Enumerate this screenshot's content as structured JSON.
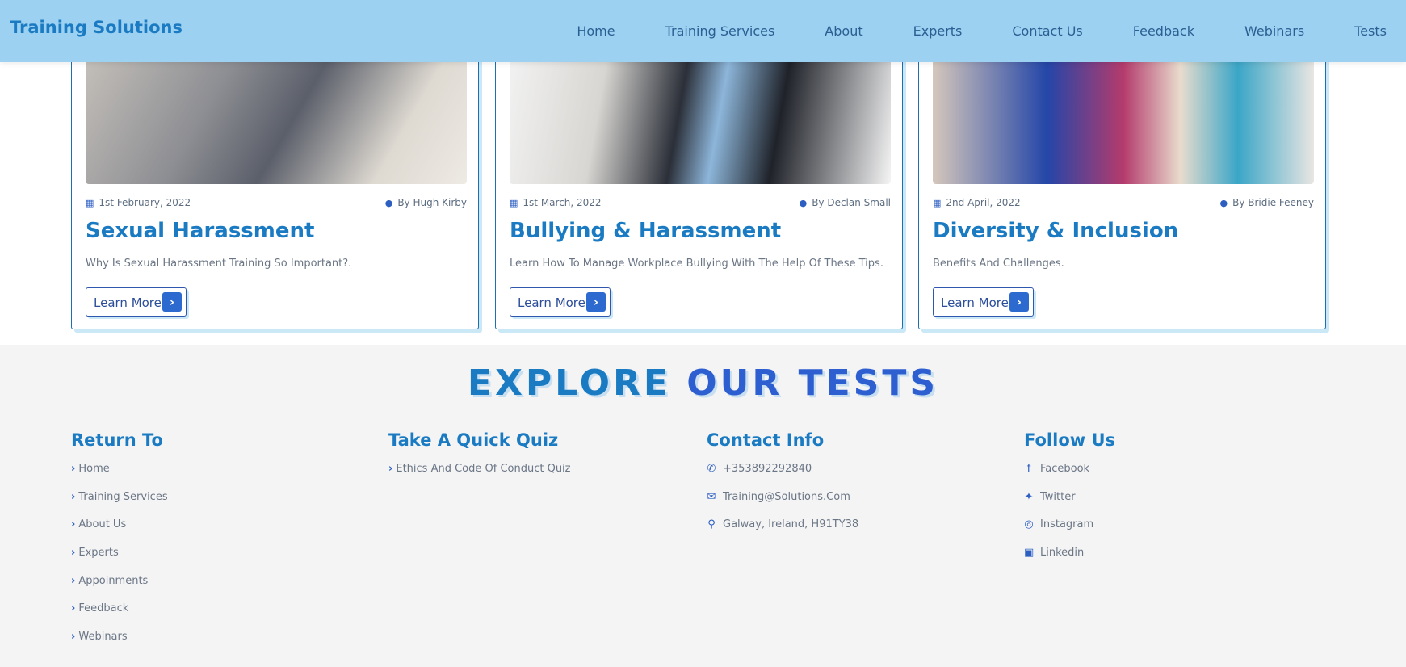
{
  "header": {
    "brand": "Training Solutions",
    "nav": [
      "Home",
      "Training Services",
      "About",
      "Experts",
      "Contact Us",
      "Feedback",
      "Webinars",
      "Tests"
    ]
  },
  "cards": [
    {
      "date": "1st February, 2022",
      "author": "By Hugh Kirby",
      "title": "Sexual Harassment",
      "description": "Why Is Sexual Harassment Training So Important?.",
      "button": "Learn More"
    },
    {
      "date": "1st March, 2022",
      "author": "By Declan Small",
      "title": "Bullying & Harassment",
      "description": "Learn How To Manage Workplace Bullying With The Help Of These Tips.",
      "button": "Learn More"
    },
    {
      "date": "2nd April, 2022",
      "author": "By Bridie Feeney",
      "title": "Diversity & Inclusion",
      "description": "Benefits And Challenges.",
      "button": "Learn More"
    }
  ],
  "footer": {
    "heading_part1": "EXPLORE",
    "heading_part2": "OUR TESTS",
    "return_to": {
      "title": "Return To",
      "links": [
        "Home",
        "Training Services",
        "About Us",
        "Experts",
        "Appoinments",
        "Feedback",
        "Webinars"
      ]
    },
    "quiz": {
      "title": "Take A Quick Quiz",
      "links": [
        "Ethics And Code Of Conduct Quiz"
      ]
    },
    "contact": {
      "title": "Contact Info",
      "phone": "+353892292840",
      "email": "Training@Solutions.Com",
      "address": "Galway, Ireland, H91TY38"
    },
    "follow": {
      "title": "Follow Us",
      "links": [
        "Facebook",
        "Twitter",
        "Instagram",
        "Linkedin"
      ]
    }
  },
  "colors": {
    "header_bg": "#9dd1f2",
    "brand_blue": "#1b7bc2",
    "accent_blue": "#2d6ad0",
    "footer_bg": "#f4f4f5"
  }
}
